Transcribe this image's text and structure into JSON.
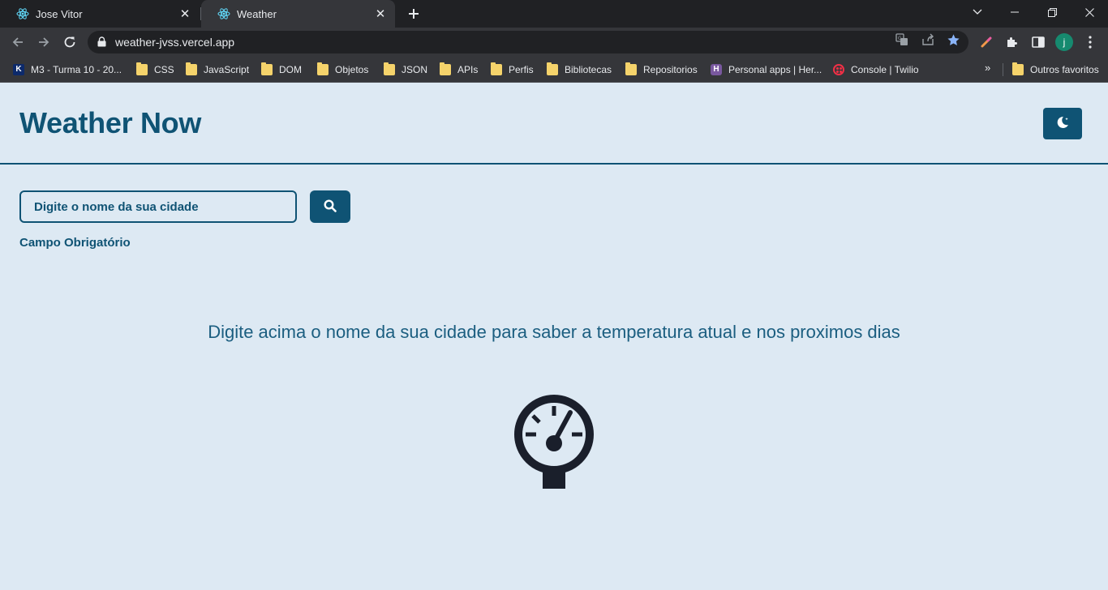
{
  "browser": {
    "tabs": [
      {
        "title": "Jose Vitor",
        "active": false
      },
      {
        "title": "Weather",
        "active": true
      }
    ],
    "url": "weather-jvss.vercel.app",
    "profile_initial": "j",
    "bookmarks": [
      {
        "label": "M3 - Turma 10 - 20...",
        "icon": "kenzie-icon"
      },
      {
        "label": "CSS",
        "icon": "folder-icon"
      },
      {
        "label": "JavaScript",
        "icon": "folder-icon"
      },
      {
        "label": "DOM",
        "icon": "folder-icon"
      },
      {
        "label": "Objetos",
        "icon": "folder-icon"
      },
      {
        "label": "JSON",
        "icon": "folder-icon"
      },
      {
        "label": "APIs",
        "icon": "folder-icon"
      },
      {
        "label": "Perfis",
        "icon": "folder-icon"
      },
      {
        "label": "Bibliotecas",
        "icon": "folder-icon"
      },
      {
        "label": "Repositorios",
        "icon": "folder-icon"
      },
      {
        "label": "Personal apps | Her...",
        "icon": "heroku-icon"
      },
      {
        "label": "Console | Twilio",
        "icon": "twilio-icon"
      }
    ],
    "bookmarks_overflow": "»",
    "other_bookmarks": "Outros favoritos"
  },
  "app": {
    "title": "Weather Now",
    "theme_toggle_icon": "moon-icon",
    "search": {
      "placeholder": "Digite o nome da sua cidade",
      "value": "",
      "button_icon": "search-icon"
    },
    "validation_message": "Campo Obrigatório",
    "empty_state": {
      "message": "Digite acima o nome da sua cidade para saber a temperatura atual e nos proximos dias",
      "icon": "gauge-icon"
    }
  },
  "colors": {
    "primary": "#0f5374",
    "background": "#dde9f3",
    "icon_dark": "#1a1f2b"
  }
}
